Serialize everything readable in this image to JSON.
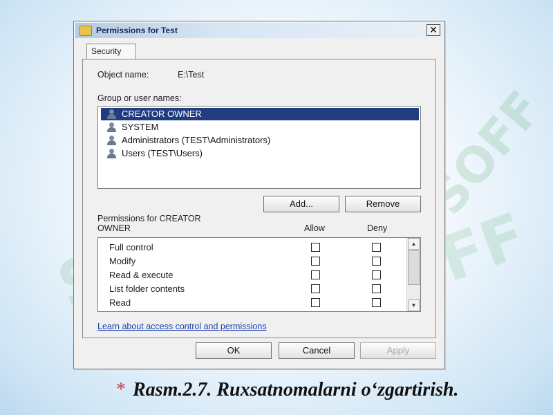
{
  "window": {
    "title": "Permissions for Test",
    "close_symbol": "✕"
  },
  "tabs": [
    {
      "label": "Security"
    }
  ],
  "object_name": {
    "label": "Object name:",
    "value": "E:\\Test"
  },
  "groups": {
    "label": "Group or user names:",
    "items": [
      {
        "label": "CREATOR OWNER",
        "selected": true,
        "icon": "user-group-icon"
      },
      {
        "label": "SYSTEM",
        "selected": false,
        "icon": "user-group-icon"
      },
      {
        "label": "Administrators (TEST\\Administrators)",
        "selected": false,
        "icon": "user-group-icon"
      },
      {
        "label": "Users (TEST\\Users)",
        "selected": false,
        "icon": "user-group-icon"
      }
    ]
  },
  "buttons": {
    "add": "Add...",
    "remove": "Remove",
    "ok": "OK",
    "cancel": "Cancel",
    "apply": "Apply"
  },
  "permissions": {
    "label_line1": "Permissions for CREATOR",
    "label_line2": "OWNER",
    "allow_header": "Allow",
    "deny_header": "Deny",
    "items": [
      {
        "name": "Full control",
        "allow": false,
        "deny": false
      },
      {
        "name": "Modify",
        "allow": false,
        "deny": false
      },
      {
        "name": "Read & execute",
        "allow": false,
        "deny": false
      },
      {
        "name": "List folder contents",
        "allow": false,
        "deny": false
      },
      {
        "name": "Read",
        "allow": false,
        "deny": false
      }
    ]
  },
  "help_link": "Learn about access control and permissions",
  "caption": {
    "star": "*",
    "text": "Rasm.2.7. Ruxsatnomalarni o‘zgartirish."
  },
  "watermark": "SOFF",
  "colors": {
    "selection": "#1f3d80",
    "link": "#1a3fb0",
    "caption_star": "#d6334a"
  }
}
